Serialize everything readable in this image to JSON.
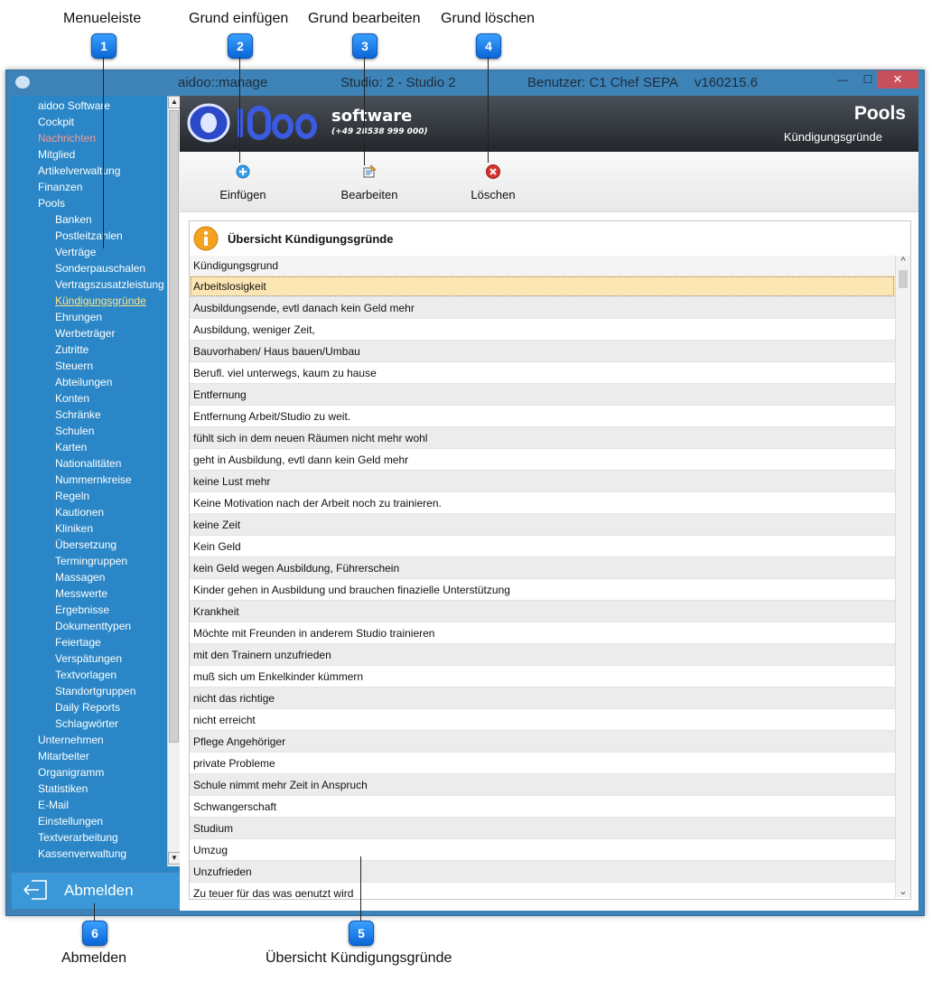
{
  "callouts": [
    {
      "num": "1",
      "label": "Menueleiste"
    },
    {
      "num": "2",
      "label": "Grund einfügen"
    },
    {
      "num": "3",
      "label": "Grund bearbeiten"
    },
    {
      "num": "4",
      "label": "Grund löschen"
    },
    {
      "num": "5",
      "label": "Übersicht Kündigungsgründe"
    },
    {
      "num": "6",
      "label": "Abmelden"
    }
  ],
  "titlebar": {
    "app": "aidoo::manage",
    "studio": "Studio: 2 - Studio 2",
    "user": "Benutzer: C1 Chef",
    "sepa": "SEPA",
    "version": "v160215.6",
    "min": "—",
    "max": "☐",
    "close": "✕"
  },
  "sidebar": {
    "items": [
      {
        "label": "aidoo Software",
        "level": 0
      },
      {
        "label": "Cockpit",
        "level": 0
      },
      {
        "label": "Nachrichten",
        "level": 0,
        "state": "red"
      },
      {
        "label": "Mitglied",
        "level": 0
      },
      {
        "label": "Artikelverwaltung",
        "level": 0
      },
      {
        "label": "Finanzen",
        "level": 0
      },
      {
        "label": "Pools",
        "level": 0
      },
      {
        "label": "Banken",
        "level": 1
      },
      {
        "label": "Postleitzahlen",
        "level": 1
      },
      {
        "label": "Verträge",
        "level": 1
      },
      {
        "label": "Sonderpauschalen",
        "level": 1
      },
      {
        "label": "Vertragszusatzleistung",
        "level": 1
      },
      {
        "label": "Kündigungsgründe",
        "level": 1,
        "state": "active"
      },
      {
        "label": "Ehrungen",
        "level": 1
      },
      {
        "label": "Werbeträger",
        "level": 1
      },
      {
        "label": "Zutritte",
        "level": 1
      },
      {
        "label": "Steuern",
        "level": 1
      },
      {
        "label": "Abteilungen",
        "level": 1
      },
      {
        "label": "Konten",
        "level": 1
      },
      {
        "label": "Schränke",
        "level": 1
      },
      {
        "label": "Schulen",
        "level": 1
      },
      {
        "label": "Karten",
        "level": 1
      },
      {
        "label": "Nationalitäten",
        "level": 1
      },
      {
        "label": "Nummernkreise",
        "level": 1
      },
      {
        "label": "Regeln",
        "level": 1
      },
      {
        "label": "Kautionen",
        "level": 1
      },
      {
        "label": "Kliniken",
        "level": 1
      },
      {
        "label": "Übersetzung",
        "level": 1
      },
      {
        "label": "Termingruppen",
        "level": 1
      },
      {
        "label": "Massagen",
        "level": 1
      },
      {
        "label": "Messwerte",
        "level": 1
      },
      {
        "label": "Ergebnisse",
        "level": 1
      },
      {
        "label": "Dokumenttypen",
        "level": 1
      },
      {
        "label": "Feiertage",
        "level": 1
      },
      {
        "label": "Verspätungen",
        "level": 1
      },
      {
        "label": "Textvorlagen",
        "level": 1
      },
      {
        "label": "Standortgruppen",
        "level": 1
      },
      {
        "label": "Daily Reports",
        "level": 1
      },
      {
        "label": "Schlagwörter",
        "level": 1
      },
      {
        "label": "Unternehmen",
        "level": 0
      },
      {
        "label": "Mitarbeiter",
        "level": 0
      },
      {
        "label": "Organigramm",
        "level": 0
      },
      {
        "label": "Statistiken",
        "level": 0
      },
      {
        "label": "E-Mail",
        "level": 0
      },
      {
        "label": "Einstellungen",
        "level": 0
      },
      {
        "label": "Textverarbeitung",
        "level": 0
      },
      {
        "label": "Kassenverwaltung",
        "level": 0
      }
    ],
    "logout_label": "Abmelden"
  },
  "header": {
    "brand": "software",
    "phone": "(+49 28538 999 000)",
    "title": "Pools",
    "subtitle": "Kündigungsgründe"
  },
  "toolbar": {
    "insert_label": "Einfügen",
    "edit_label": "Bearbeiten",
    "delete_label": "Löschen"
  },
  "panel": {
    "title": "Übersicht Kündigungsgründe",
    "column": "Kündigungsgrund",
    "selected_index": 0,
    "rows": [
      "Arbeitslosigkeit",
      "Ausbildungsende, evtl danach kein Geld mehr",
      "Ausbildung, weniger Zeit,",
      "Bauvorhaben/ Haus bauen/Umbau",
      "Berufl. viel unterwegs, kaum zu hause",
      "Entfernung",
      "Entfernung Arbeit/Studio zu weit.",
      "fühlt sich in dem neuen Räumen nicht mehr wohl",
      "geht in Ausbildung, evtl dann kein Geld mehr",
      "keine Lust mehr",
      "Keine Motivation nach der Arbeit noch zu trainieren.",
      "keine Zeit",
      "Kein Geld",
      "kein Geld wegen Ausbildung, Führerschein",
      "Kinder gehen in Ausbildung und brauchen finazielle Unterstützung",
      "Krankheit",
      "Möchte mit Freunden in anderem Studio trainieren",
      "mit den Trainern unzufrieden",
      "muß sich um Enkelkinder kümmern",
      "nicht das richtige",
      "nicht erreicht",
      "Pflege Angehöriger",
      "private Probleme",
      "Schule nimmt mehr Zeit in Anspruch",
      "Schwangerschaft",
      "Studium",
      "Umzug",
      "Unzufrieden",
      "Zu teuer für das was genutzt wird"
    ]
  }
}
